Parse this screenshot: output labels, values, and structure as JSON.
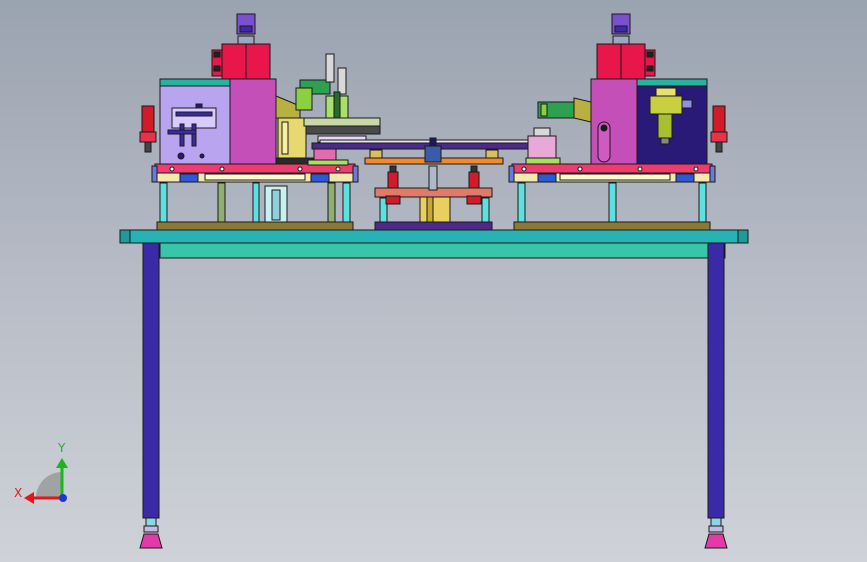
{
  "triad": {
    "x_label": "X",
    "y_label": "Y"
  },
  "colors": {
    "frame": "#3b2aa8",
    "table_top": "#27b3b3",
    "plate": "#ef3b6e",
    "block": "#c54fb8",
    "panel_lavender": "#b9a4ef",
    "panel_navy": "#2a1a78",
    "cylinder": "#e8164a",
    "knob": "#7a4fd0",
    "green": "#1f9b3a",
    "orange": "#f08a2c",
    "olive": "#8a7a36",
    "red_valve": "#d11a2a",
    "foot": "#e23aa8",
    "axis_x": "#e01818",
    "axis_y": "#18b818",
    "axis_z": "#1838d8"
  }
}
